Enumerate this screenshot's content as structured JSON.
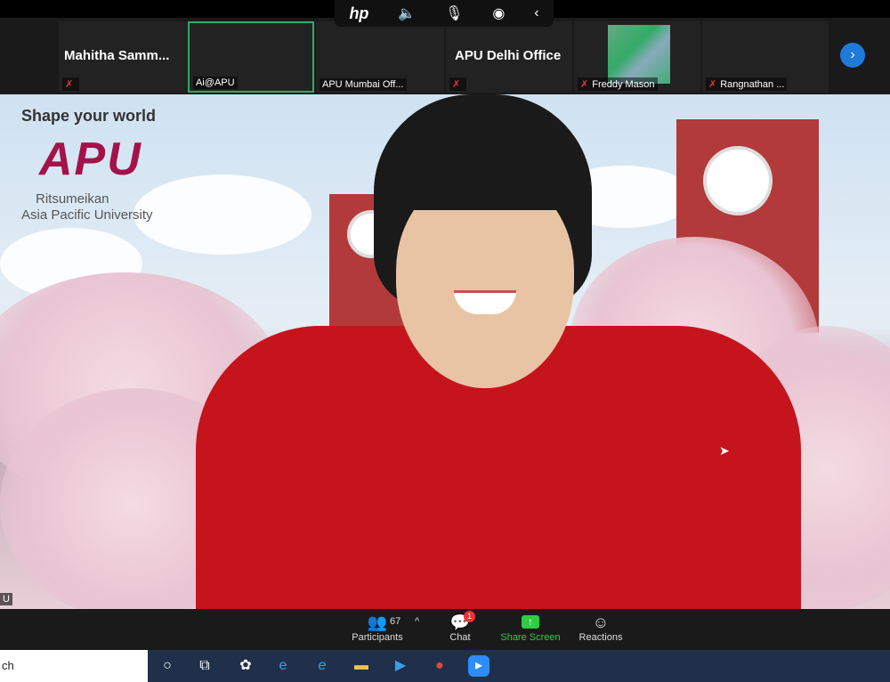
{
  "hp_bar": {
    "logo": "hp",
    "icons": [
      "speaker-icon",
      "mic-icon",
      "broadcast-icon",
      "collapse-chevron-icon"
    ]
  },
  "participants": [
    {
      "name": "Mahitha  Samm...",
      "label": "",
      "muted": true
    },
    {
      "name": "",
      "label": "Ai@APU",
      "muted": false,
      "active": true
    },
    {
      "name": "",
      "label": "APU Mumbai Off...",
      "muted": false
    },
    {
      "name": "APU Delhi Office",
      "label": "",
      "muted": true
    },
    {
      "name": "",
      "label": "Freddy Mason",
      "muted": true,
      "has_video": true
    },
    {
      "name": "",
      "label": "Rangnathan ...",
      "muted": true
    }
  ],
  "main_video": {
    "tagline": "Shape your world",
    "logo": "APU",
    "university_line1": "Ritsumeikan",
    "university_line2": "Asia Pacific University",
    "corner_label": "U"
  },
  "toolbar": {
    "participants_label": "Participants",
    "participants_count": "67",
    "chat_label": "Chat",
    "chat_badge": "1",
    "share_label": "Share Screen",
    "reactions_label": "Reactions"
  },
  "taskbar": {
    "search_text": "ch",
    "icons": [
      "cortana-icon",
      "task-view-icon",
      "app-icon",
      "edge-icon",
      "ie-icon",
      "file-explorer-icon",
      "video-app-icon",
      "chrome-icon",
      "zoom-icon"
    ]
  },
  "colors": {
    "accent": "#1e7bd9",
    "share_green": "#2ecc40",
    "badge_red": "#e33333",
    "apu_logo": "#a3134a"
  }
}
